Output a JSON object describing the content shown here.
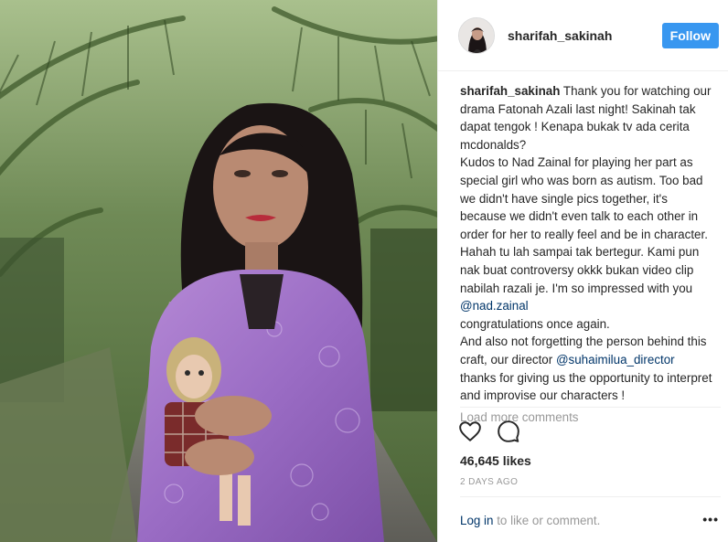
{
  "post": {
    "author": "sharifah_sakinah",
    "follow_label": "Follow",
    "caption_author": "sharifah_sakinah",
    "caption_part1": " Thank you for watching our drama Fatonah Azali last night! Sakinah tak dapat tengok ! Kenapa bukak tv ada cerita mcdonalds?\nKudos to Nad Zainal for playing her part as special girl who was born as autism. Too bad we didn't have single pics together, it's because we didn't even talk to each other in order for her to really feel and be in character. Hahah tu lah sampai tak bertegur. Kami pun nak buat controversy okkk bukan video clip nabilah razali je. I'm so impressed with you ",
    "mention1": "@nad.zainal",
    "caption_part2": "\ncongratulations once again.\nAnd also not forgetting the person behind this craft, our director ",
    "mention2": "@suhaimilua_director",
    "caption_part3": "\nthanks for giving us the opportunity to interpret and improvise our characters !",
    "load_more": "Load more comments",
    "likes": "46,645 likes",
    "date": "2 DAYS AGO",
    "login_link": "Log in",
    "login_rest": " to like or comment.",
    "more_glyph": "•••"
  },
  "icons": {
    "like": "heart-outline-icon",
    "comment": "speech-bubble-icon",
    "more": "more-options-icon"
  },
  "colors": {
    "follow_button": "#3897f0",
    "mention": "#003569",
    "muted": "#999999",
    "text": "#262626"
  }
}
